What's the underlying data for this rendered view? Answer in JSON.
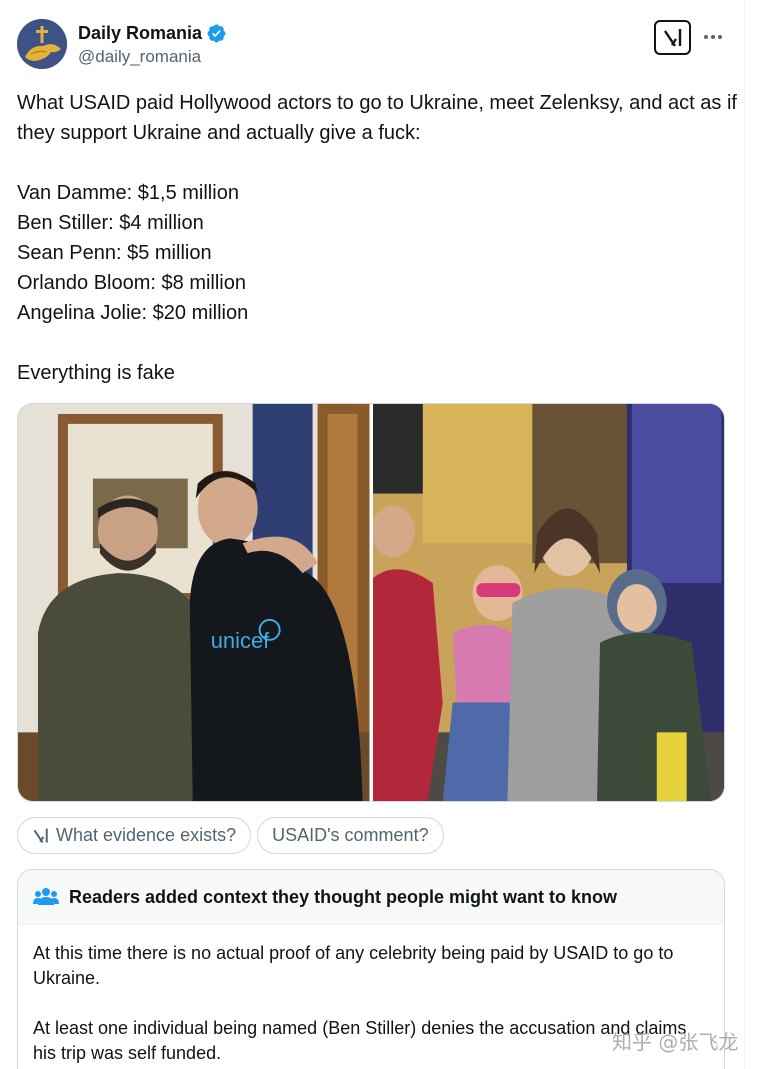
{
  "author": {
    "display_name": "Daily Romania",
    "handle": "@daily_romania",
    "verified": true,
    "avatar_icon": "romania-eagle-cross-logo"
  },
  "header_actions": {
    "grok_icon": "grok-icon",
    "more_icon": "more-dots-icon"
  },
  "tweet": {
    "intro": "What USAID paid Hollywood actors to go to Ukraine, meet Zelenksy, and act as if they support Ukraine and actually give a fuck:",
    "list": [
      "Van Damme: $1,5 million",
      "Ben Stiller: $4 million",
      "Sean Penn: $5 million",
      "Orlando Bloom: $8 million",
      "Angelina Jolie: $20 million"
    ],
    "closing": "Everything is fake"
  },
  "media": {
    "photos": [
      {
        "name": "photo-zelensky-bloom",
        "shirt_text": "unicef"
      },
      {
        "name": "photo-jolie-children"
      }
    ]
  },
  "chips": [
    {
      "label": "What evidence exists?",
      "icon": "grok-icon"
    },
    {
      "label": "USAID's comment?"
    }
  ],
  "note": {
    "title": "Readers added context they thought people might want to know",
    "icon": "people-icon",
    "paragraphs": [
      "At this time there is no actual proof of any celebrity being paid by USAID to go to Ukraine.",
      "At least one individual being named (Ben Stiller) denies the accusation and claims his trip was self funded."
    ]
  },
  "watermark": "知乎 @张飞龙",
  "colors": {
    "verified_blue": "#1d9bf0",
    "secondary_text": "#536471",
    "border": "#cfd9de",
    "note_icon_blue": "#1d9bf0"
  }
}
